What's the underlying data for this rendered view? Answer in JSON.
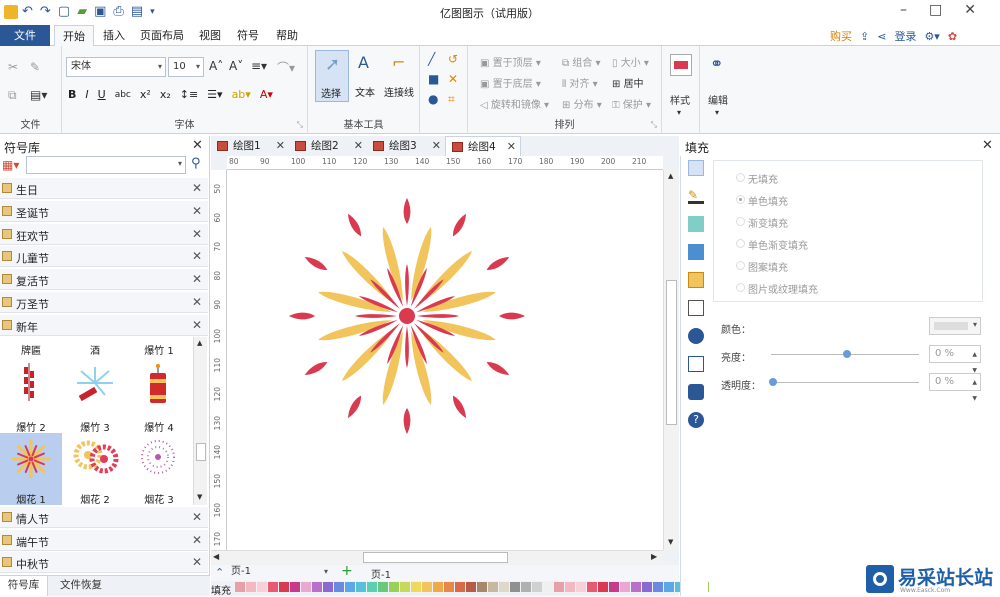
{
  "window": {
    "title": "亿图图示（试用版）"
  },
  "menu": {
    "file": "文件",
    "tabs": [
      "开始",
      "插入",
      "页面布局",
      "视图",
      "符号",
      "帮助"
    ],
    "right": {
      "buy": "购买",
      "login": "登录"
    }
  },
  "ribbon": {
    "group_labels": {
      "file": "文件",
      "font": "字体",
      "tools": "基本工具",
      "arrange": "排列"
    },
    "font_name": "宋体",
    "font_size": "10",
    "tools": {
      "select": "选择",
      "text": "文本",
      "connector": "连接线"
    },
    "arrange": {
      "bring_front": "置于顶层",
      "send_back": "置于底层",
      "rotate": "旋转和镜像",
      "group": "组合",
      "align": "对齐",
      "distribute": "分布",
      "size": "大小",
      "center": "居中",
      "protect": "保护"
    },
    "style": "样式",
    "edit": "编辑"
  },
  "library": {
    "title": "符号库",
    "categories_top": [
      "生日",
      "圣诞节",
      "狂欢节",
      "儿童节",
      "复活节",
      "万圣节",
      "新年"
    ],
    "symbols_row1": [
      "牌匾",
      "酒",
      "爆竹 1"
    ],
    "symbols_row2": [
      "爆竹 2",
      "爆竹 3",
      "爆竹 4"
    ],
    "symbols_row3": [
      "烟花 1",
      "烟花 2",
      "烟花 3"
    ],
    "categories_bottom": [
      "情人节",
      "端午节",
      "中秋节"
    ],
    "bottom_tabs": [
      "符号库",
      "文件恢复"
    ]
  },
  "documents": {
    "tabs": [
      "绘图1",
      "绘图2",
      "绘图3",
      "绘图4"
    ],
    "active": 3
  },
  "rulers": {
    "h": [
      "80",
      "90",
      "100",
      "110",
      "120",
      "130",
      "140",
      "150",
      "160",
      "170",
      "180",
      "190",
      "200",
      "210"
    ],
    "v": [
      "50",
      "60",
      "70",
      "80",
      "90",
      "100",
      "110",
      "120",
      "130",
      "140",
      "150",
      "160",
      "170"
    ]
  },
  "fill_panel": {
    "title": "填充",
    "options": [
      "无填充",
      "单色填充",
      "渐变填充",
      "单色渐变填充",
      "图案填充",
      "图片或纹理填充"
    ],
    "selected_option": "单色填充",
    "color_label": "颜色：",
    "brightness_label": "亮度：",
    "brightness_value": "0 %",
    "transparency_label": "透明度：",
    "transparency_value": "0 %"
  },
  "pages": {
    "page_select": "页-1",
    "page_tab": "页-1",
    "fill_label": "填充"
  },
  "colors": {
    "accent": "#2b5797",
    "firework_yellow": "#f2c45c",
    "firework_red": "#d93a4f",
    "selected_symbol_bg": "#b9cdee"
  },
  "watermark": {
    "text": "易采站长站",
    "sub": "Www.Easck.Com"
  }
}
